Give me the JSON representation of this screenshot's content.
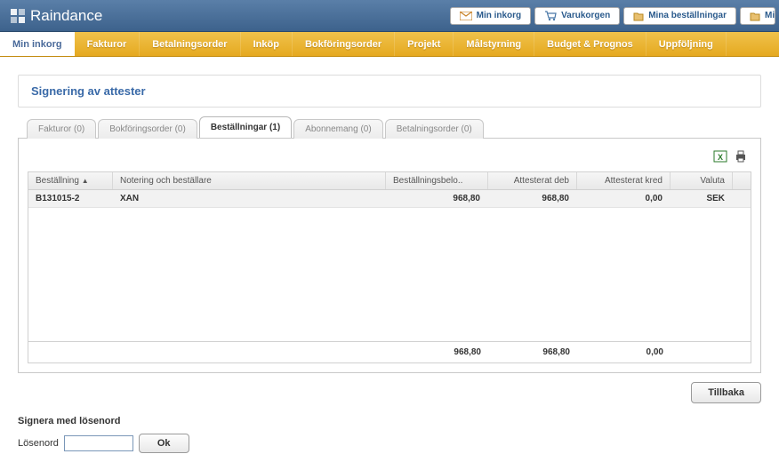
{
  "app": {
    "name": "Raindance"
  },
  "top_links": [
    {
      "label": "Min inkorg"
    },
    {
      "label": "Varukorgen"
    },
    {
      "label": "Mina beställningar"
    },
    {
      "label": "Mi"
    }
  ],
  "nav": [
    {
      "label": "Min inkorg",
      "active": true
    },
    {
      "label": "Fakturor"
    },
    {
      "label": "Betalningsorder"
    },
    {
      "label": "Inköp"
    },
    {
      "label": "Bokföringsorder"
    },
    {
      "label": "Projekt"
    },
    {
      "label": "Målstyrning"
    },
    {
      "label": "Budget & Prognos"
    },
    {
      "label": "Uppföljning"
    }
  ],
  "page": {
    "title": "Signering av attester"
  },
  "tabs": [
    {
      "label": "Fakturor (0)"
    },
    {
      "label": "Bokföringsorder (0)"
    },
    {
      "label": "Beställningar (1)",
      "active": true
    },
    {
      "label": "Abonnemang (0)"
    },
    {
      "label": "Betalningsorder (0)"
    }
  ],
  "grid": {
    "headers": {
      "bestallning": "Beställning",
      "notering": "Notering och beställare",
      "belopp": "Beställningsbelo..",
      "deb": "Attesterat deb",
      "kred": "Attesterat kred",
      "valuta": "Valuta"
    },
    "rows": [
      {
        "bestallning": "B131015-2",
        "notering": "XAN",
        "belopp": "968,80",
        "deb": "968,80",
        "kred": "0,00",
        "valuta": "SEK"
      }
    ],
    "totals": {
      "belopp": "968,80",
      "deb": "968,80",
      "kred": "0,00"
    }
  },
  "buttons": {
    "back": "Tillbaka",
    "ok": "Ok"
  },
  "signer": {
    "title": "Signera med lösenord",
    "password_label": "Lösenord"
  },
  "sort_indicator": "▲"
}
